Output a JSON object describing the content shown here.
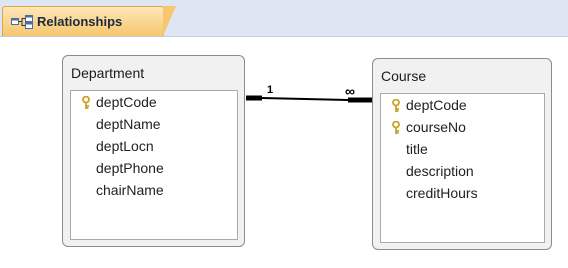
{
  "tab": {
    "label": "Relationships",
    "icon": "relationships-icon"
  },
  "tables": {
    "department": {
      "title": "Department",
      "fields": [
        {
          "name": "deptCode",
          "primary_key": true
        },
        {
          "name": "deptName",
          "primary_key": false
        },
        {
          "name": "deptLocn",
          "primary_key": false
        },
        {
          "name": "deptPhone",
          "primary_key": false
        },
        {
          "name": "chairName",
          "primary_key": false
        }
      ]
    },
    "course": {
      "title": "Course",
      "fields": [
        {
          "name": "deptCode",
          "primary_key": true
        },
        {
          "name": "courseNo",
          "primary_key": true
        },
        {
          "name": "title",
          "primary_key": false
        },
        {
          "name": "description",
          "primary_key": false
        },
        {
          "name": "creditHours",
          "primary_key": false
        }
      ]
    }
  },
  "relationship": {
    "one_side": "1",
    "many_side": "∞"
  },
  "colors": {
    "tab_fill": "#f7c66e",
    "tab_strip": "#dde6f2",
    "key_icon": "#c9a227"
  }
}
